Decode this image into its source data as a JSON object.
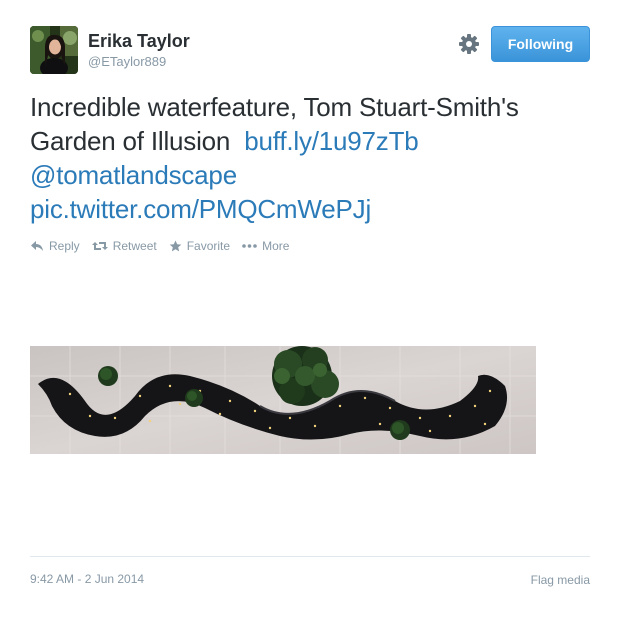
{
  "user": {
    "name": "Erika Taylor",
    "handle": "@ETaylor889"
  },
  "follow_button": {
    "label": "Following"
  },
  "tweet": {
    "text_line1": "Incredible waterfeature, Tom Stuart-Smith's",
    "text_line2": "Garden of Illusion",
    "link": "buff.ly/1u97zTb",
    "mention": "@tomatlandscape",
    "pic_link": "pic.twitter.com/PMQCmWePJj"
  },
  "actions": {
    "reply": "Reply",
    "retweet": "Retweet",
    "favorite": "Favorite",
    "more": "More"
  },
  "footer": {
    "timestamp": "9:42 AM - 2 Jun 2014",
    "flag": "Flag media"
  },
  "colors": {
    "link": "#2b7bb9",
    "button": "#3b94d9",
    "muted": "#8899a6"
  }
}
